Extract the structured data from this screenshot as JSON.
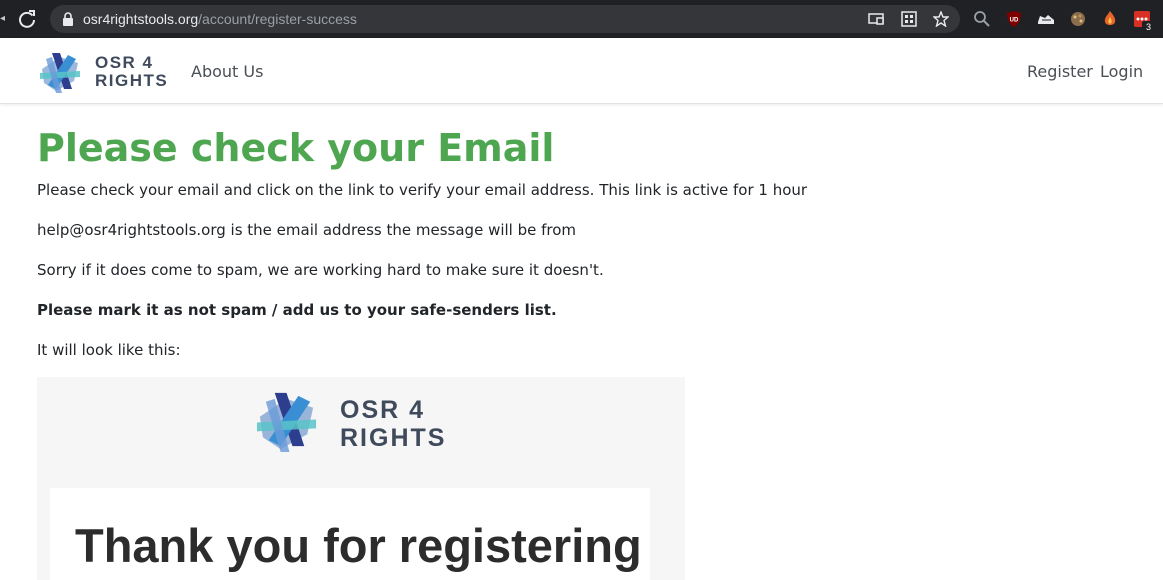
{
  "browser": {
    "url_host": "osr4rightstools.org",
    "url_path": "/account/register-success",
    "extension_badge": "3",
    "extension_label": "UD"
  },
  "navbar": {
    "brand_line1": "OSR 4",
    "brand_line2": "RIGHTS",
    "about": "About Us",
    "register": "Register",
    "login": "Login"
  },
  "content": {
    "title": "Please check your Email",
    "p1": "Please check your email and click on the link to verify your email address. This link is active for 1 hour",
    "p2": "help@osr4rightstools.org is the email address the message will be from",
    "p3": "Sorry if it does come to spam, we are working hard to make sure it doesn't.",
    "p4": "Please mark it as not spam / add us to your safe-senders list.",
    "p5": "It will look like this:"
  },
  "email_preview": {
    "logo_line1": "OSR 4",
    "logo_line2": "RIGHTS",
    "heading": "Thank you for registering"
  },
  "colors": {
    "title_green": "#4ea650",
    "brand_text": "#3f4a5c",
    "chrome_bg": "#202124",
    "omnibox_bg": "#35363a"
  }
}
